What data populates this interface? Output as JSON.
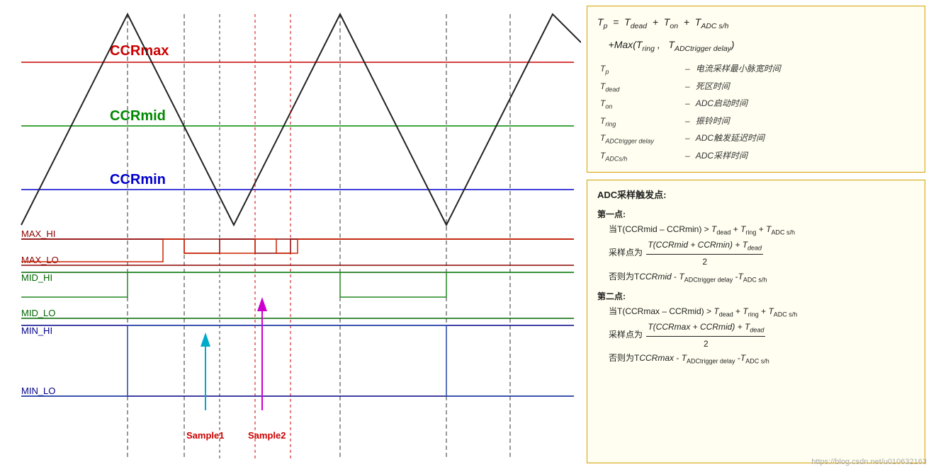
{
  "waveform": {
    "labels": {
      "CCRmax": "CCRmax",
      "CCRmid": "CCRmid",
      "CCRmin": "CCRmin",
      "MAX_HI": "MAX_HI",
      "MAX_LO": "MAX_LO",
      "MID_HI": "MID_HI",
      "MID_LO": "MID_LO",
      "MIN_HI": "MIN_HI",
      "MIN_LO": "MIN_LO",
      "Sample1": "Sample1",
      "Sample2": "Sample2"
    }
  },
  "formula_box": {
    "line1": "Tₚ = T_dead + T_on + T_ADC s/h",
    "line2": "+ Max(T_ring, T_ADCtrigger delay)",
    "legend": [
      [
        "Tₚ",
        "–",
        "电流采样最小脉宽时间"
      ],
      [
        "T_dead",
        "–",
        "死区时间"
      ],
      [
        "T_on",
        "–",
        "ADC启动时间"
      ],
      [
        "T_ring",
        "–",
        "振铃时间"
      ],
      [
        "T_ADCtrigger delay",
        "–",
        "ADC触发延迟时间"
      ],
      [
        "T_ADCs/h",
        "–",
        "ADC采样时间"
      ]
    ]
  },
  "adc_box": {
    "title": "ADC采样触发点:",
    "point1_title": "第一点:",
    "point1_condition": "当T(CCRmid – CCRmin) > T_dead + T_ring + T_ADC s/h",
    "point1_sample": "采样点为",
    "point1_fraction_num": "T(CCRmid + CCRmin) + Tdead",
    "point1_fraction_den": "2",
    "point1_else": "否则为TCCRmid - T_ADCtrigger delay - T_ADC s/h",
    "point2_title": "第二点:",
    "point2_condition": "当T(CCRmax – CCRmid) > T_dead + T_ring + T_ADC s/h",
    "point2_sample": "采样点为",
    "point2_fraction_num": "T(CCRmax + CCRmid) + Tdead",
    "point2_fraction_den": "2",
    "point2_else": "否则为TCCRmax - T_ADCtrigger delay - T_ADC s/h"
  },
  "watermark": "https://blog.csdn.net/u010632163"
}
